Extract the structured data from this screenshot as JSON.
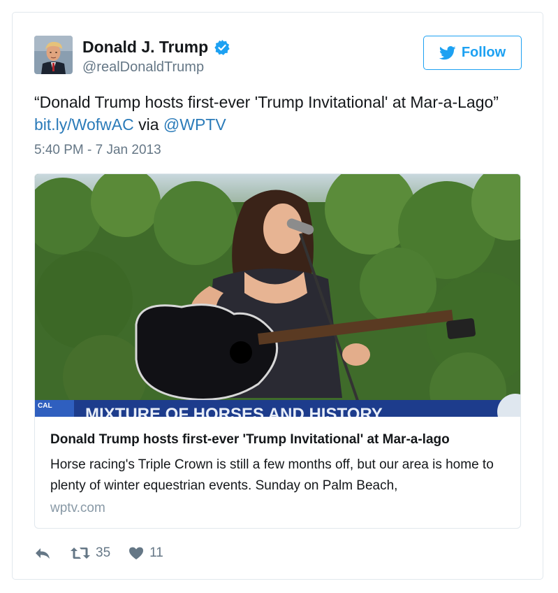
{
  "user": {
    "display_name": "Donald J. Trump",
    "screen_name": "@realDonaldTrump",
    "verified": true
  },
  "follow_button": {
    "label": "Follow"
  },
  "tweet": {
    "text_before": "“Donald Trump hosts first-ever 'Trump Invitational' at Mar-a-Lago” ",
    "link": "bit.ly/WofwAC",
    "text_via": " via ",
    "mention": "@WPTV",
    "timestamp": "5:40 PM - 7 Jan 2013"
  },
  "card": {
    "lower_third_text": "MIXTURE OF HORSES AND HISTORY",
    "corner_tag": "CAL",
    "title": "Donald Trump hosts first-ever 'Trump Invitational' at Mar-a-lago",
    "description": "Horse racing's Triple Crown is still a few months off, but our area is home to plenty of winter equestrian events. Sunday on Palm Beach,",
    "domain": "wptv.com"
  },
  "actions": {
    "retweets": "35",
    "likes": "11"
  },
  "colors": {
    "link": "#2b7bb9",
    "twitter_blue": "#1da1f2",
    "muted": "#657786",
    "border": "#e1e8ed"
  }
}
